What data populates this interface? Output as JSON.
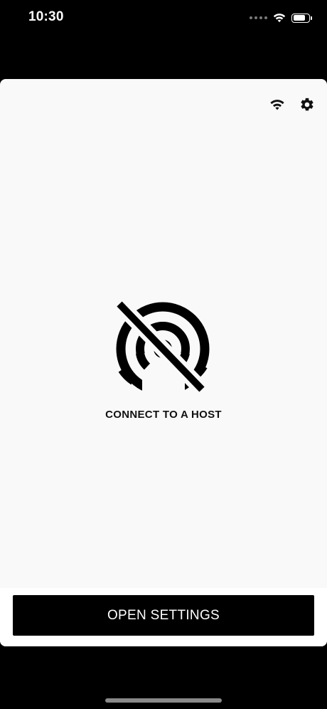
{
  "status_bar": {
    "time": "10:30",
    "icons": [
      "cellular-signal-icon",
      "wifi-icon",
      "battery-icon"
    ],
    "text_color": "#ffffff",
    "battery_level": 0.82
  },
  "app": {
    "background": "#f9f9f9",
    "top_actions": {
      "icons": [
        "wifi-icon",
        "gear-icon"
      ]
    },
    "empty_state": {
      "icon": "no-broadcast-icon",
      "label": "CONNECT TO A HOST"
    },
    "primary_button": {
      "label": "OPEN SETTINGS",
      "background": "#000000",
      "text_color": "#ffffff"
    }
  }
}
